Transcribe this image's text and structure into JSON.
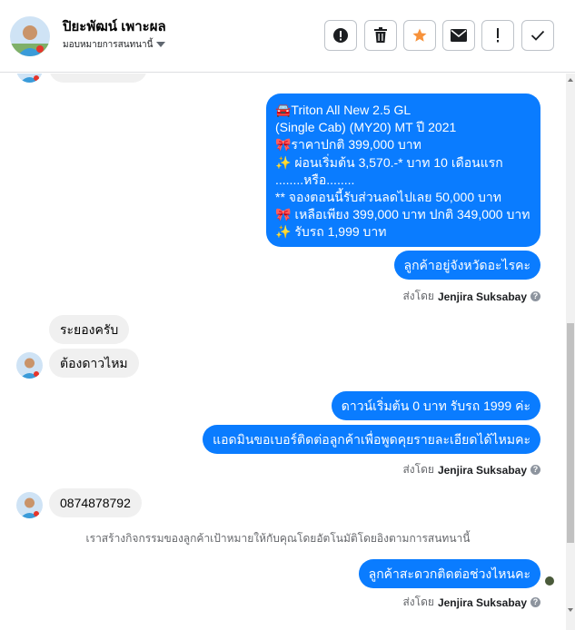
{
  "header": {
    "name": "ปิยะพัฒน์ เพาะผล",
    "assign_label": "มอบหมายการสนทนานี้",
    "toolbar_icons": [
      "alert-circle-icon",
      "trash-icon",
      "star-icon",
      "envelope-icon",
      "exclamation-icon",
      "check-icon"
    ],
    "accent_color": "#f7923b"
  },
  "big_message": {
    "lines": [
      "🚘Triton All New 2.5 GL",
      "(Single Cab) (MY20) MT ปี 2021",
      "🎀ราคาปกติ 399,000 บาท",
      "✨ ผ่อนเริ่มต้น 3,570.-* บาท 10 เดือนแรก",
      "........หรือ........",
      "** จองตอนนี้รับส่วนลดไปเลย 50,000 บาท",
      "🎀 เหลือเพียง 399,000 บาท ปกติ 349,000 บาท",
      "✨ รับรถ 1,999 บาท"
    ]
  },
  "messages": [
    {
      "text": "ลูกค้าอยู่จังหวัดอะไรคะ"
    },
    {
      "text": "ระยองครับ"
    },
    {
      "text": "ต้องดาวไหม"
    },
    {
      "text": "ดาวน์เริ่มต้น 0 บาท รับรถ 1999 ค่ะ"
    },
    {
      "text": "แอดมินขอเบอร์ติดต่อลูกค้าเพื่อพูดคุยรายละเอียดได้ไหมคะ"
    },
    {
      "text": "0874878792"
    },
    {
      "text": "ลูกค้าสะดวกติดต่อช่วงไหนคะ"
    }
  ],
  "sent_by": {
    "prefix": "ส่งโดย",
    "name": "Jenjira Suksabay"
  },
  "notice": "เราสร้างกิจกรรมของลูกค้าเป้าหมายให้กับคุณโดยอัตโนมัติโดยอิงตามการสนทนานี้",
  "colors": {
    "outgoing": "#0a7cff",
    "incoming": "#f0f0f0"
  }
}
